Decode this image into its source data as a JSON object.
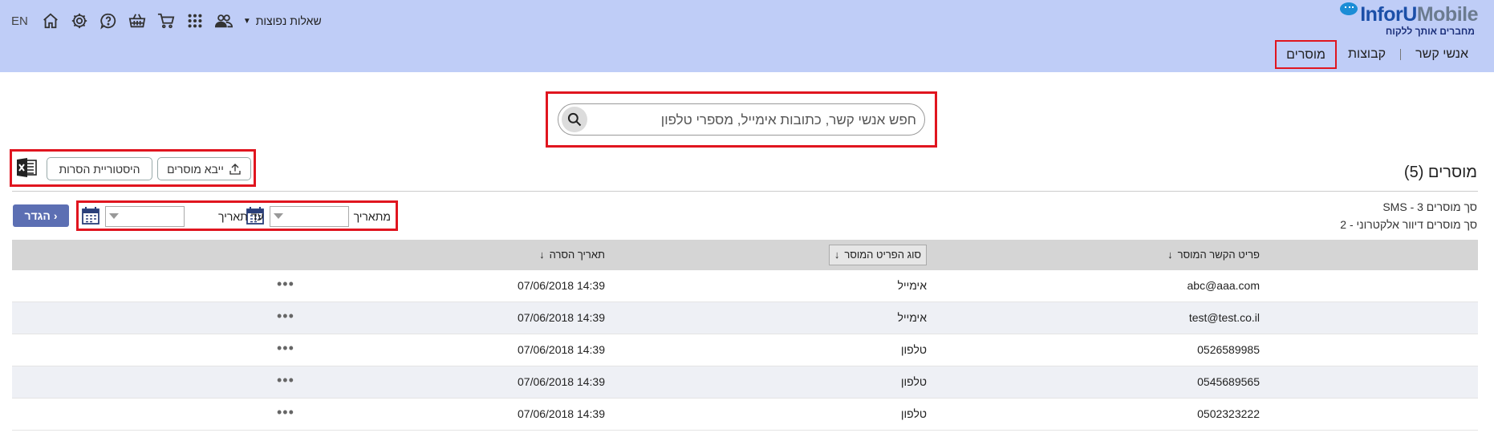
{
  "header": {
    "logo": {
      "brand_part1": "InforU",
      "brand_part2": "Mobile",
      "tagline": "מחברים אותך ללקוח"
    },
    "nav": [
      {
        "label": "אנשי קשר",
        "active": false
      },
      {
        "label": "קבוצות",
        "active": false
      },
      {
        "label": "מוסרים",
        "active": true
      }
    ],
    "faq_label": "שאלות נפוצות",
    "lang_label": "EN"
  },
  "search": {
    "placeholder": "חפש אנשי קשר, כתובות אימייל, מספרי טלפון"
  },
  "actions": {
    "import_label": "ייבא מוסרים",
    "history_label": "היסטוריית הסרות"
  },
  "section": {
    "title": "מוסרים (5)",
    "stat_sms": "סך מוסרים SMS - 3",
    "stat_email": "סך מוסרים דיוור אלקטרוני - 2"
  },
  "filter": {
    "from_label": "מתאריך",
    "to_label": "עד תאריך",
    "set_label": "הגדר"
  },
  "table": {
    "headers": {
      "detail": "פריט הקשר המוסר",
      "type": "סוג הפריט המוסר",
      "date": "תאריך הסרה"
    },
    "rows": [
      {
        "detail": "abc@aaa.com",
        "type": "אימייל",
        "date": "07/06/2018 14:39"
      },
      {
        "detail": "test@test.co.il",
        "type": "אימייל",
        "date": "07/06/2018 14:39"
      },
      {
        "detail": "0526589985",
        "type": "טלפון",
        "date": "07/06/2018 14:39"
      },
      {
        "detail": "0545689565",
        "type": "טלפון",
        "date": "07/06/2018 14:39"
      },
      {
        "detail": "0502323222",
        "type": "טלפון",
        "date": "07/06/2018 14:39"
      }
    ],
    "more_label": "•••"
  },
  "colors": {
    "header_bg": "#bfcdf7",
    "highlight": "#e0151f",
    "primary_button": "#5c6fb3",
    "row_alt": "#eef0f5"
  }
}
